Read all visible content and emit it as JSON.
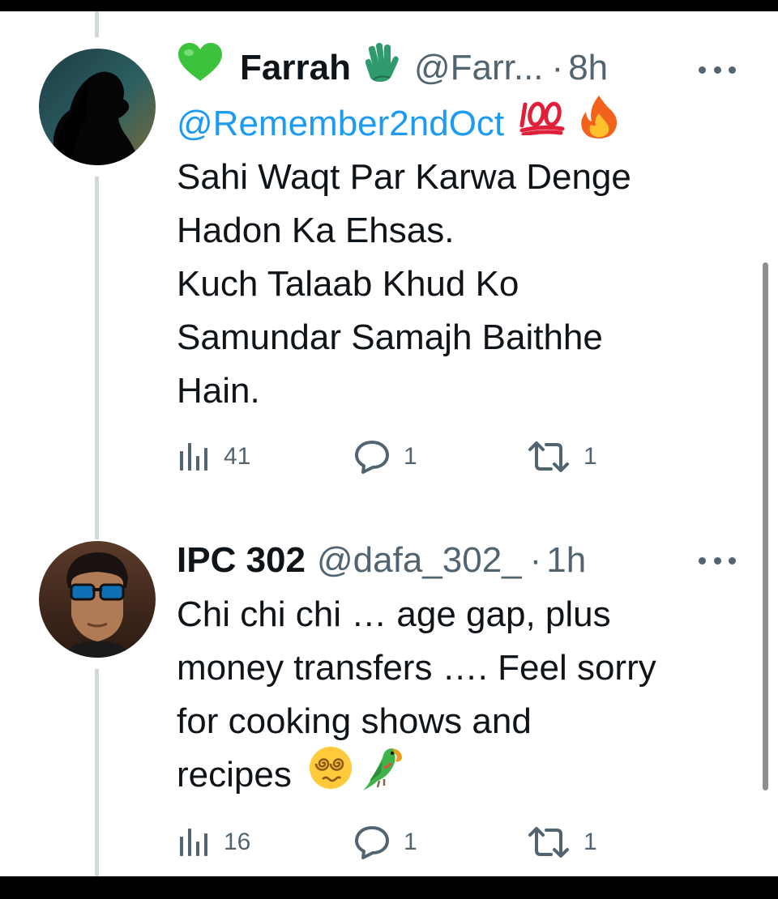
{
  "tweets": [
    {
      "display_name": "Farrah",
      "handle": "@Farr...",
      "separator": "·",
      "time": "8h",
      "mention": "@Remember2ndOct",
      "lines": [
        "Sahi Waqt Par Karwa Denge",
        "Hadon Ka Ehsas.",
        "Kuch Talaab Khud Ko",
        "Samundar Samajh Baithhe",
        "Hain."
      ],
      "stats": {
        "views": "41",
        "replies": "1",
        "retweets": "1"
      },
      "icons": [
        "green-heart-icon",
        "waving-hand-icon",
        "hundred-points-icon",
        "fire-icon"
      ]
    },
    {
      "display_name": "IPC 302",
      "handle": "@dafa_302_",
      "separator": "·",
      "time": "1h",
      "lines": [
        "Chi chi chi … age gap, plus",
        "money transfers ….  Feel sorry",
        "for  cooking shows and",
        "recipes"
      ],
      "stats": {
        "views": "16",
        "replies": "1",
        "retweets": "1"
      },
      "icons": [
        "dizzy-face-icon",
        "parrot-icon"
      ]
    }
  ],
  "colors": {
    "text": "#0f1419",
    "secondary": "#536471",
    "link": "#1d9bf0",
    "thread_line": "#cfd9de"
  }
}
